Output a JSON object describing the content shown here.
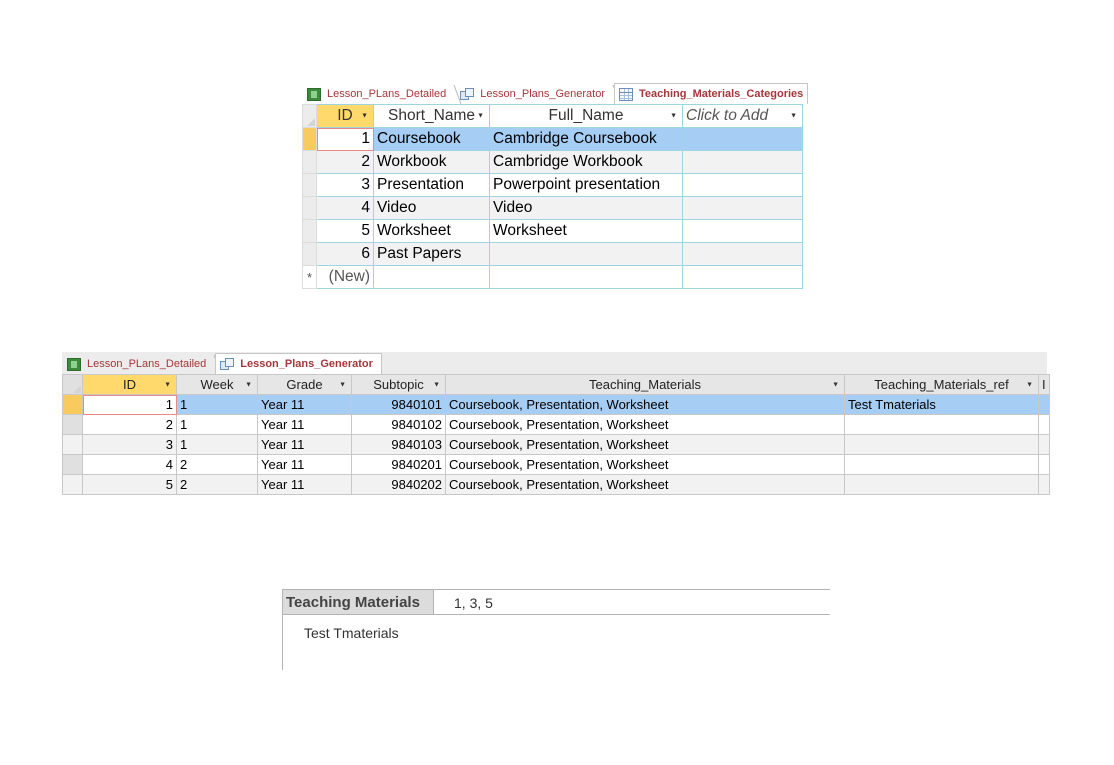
{
  "categories_view": {
    "tabs": [
      {
        "label": "Lesson_PLans_Detailed",
        "icon": "form-icon",
        "active": false
      },
      {
        "label": "Lesson_Plans_Generator",
        "icon": "query-icon",
        "active": false
      },
      {
        "label": "Teaching_Materials_Categories",
        "icon": "table-icon",
        "active": true
      }
    ],
    "columns": [
      "ID",
      "Short_Name",
      "Full_Name",
      "Click to Add"
    ],
    "rows": [
      {
        "id": "1",
        "short_name": "Coursebook",
        "full_name": "Cambridge Coursebook"
      },
      {
        "id": "2",
        "short_name": "Workbook",
        "full_name": "Cambridge Workbook"
      },
      {
        "id": "3",
        "short_name": "Presentation",
        "full_name": "Powerpoint presentation"
      },
      {
        "id": "4",
        "short_name": "Video",
        "full_name": "Video"
      },
      {
        "id": "5",
        "short_name": "Worksheet",
        "full_name": "Worksheet"
      },
      {
        "id": "6",
        "short_name": "Past Papers",
        "full_name": ""
      }
    ],
    "new_row_marker": "*",
    "new_row_label": "(New)"
  },
  "generator_view": {
    "tabs": [
      {
        "label": "Lesson_PLans_Detailed",
        "icon": "form-icon",
        "active": false
      },
      {
        "label": "Lesson_Plans_Generator",
        "icon": "query-icon",
        "active": true
      }
    ],
    "columns": [
      "ID",
      "Week",
      "Grade",
      "Subtopic",
      "Teaching_Materials",
      "Teaching_Materials_ref",
      "I"
    ],
    "rows": [
      {
        "id": "1",
        "week": "1",
        "grade": "Year 11",
        "subtopic": "9840101",
        "teaching_materials": "Coursebook, Presentation, Worksheet",
        "teaching_materials_ref": "Test Tmaterials"
      },
      {
        "id": "2",
        "week": "1",
        "grade": "Year 11",
        "subtopic": "9840102",
        "teaching_materials": "Coursebook, Presentation, Worksheet",
        "teaching_materials_ref": ""
      },
      {
        "id": "3",
        "week": "1",
        "grade": "Year 11",
        "subtopic": "9840103",
        "teaching_materials": "Coursebook, Presentation, Worksheet",
        "teaching_materials_ref": ""
      },
      {
        "id": "4",
        "week": "2",
        "grade": "Year 11",
        "subtopic": "9840201",
        "teaching_materials": "Coursebook, Presentation, Worksheet",
        "teaching_materials_ref": ""
      },
      {
        "id": "5",
        "week": "2",
        "grade": "Year 11",
        "subtopic": "9840202",
        "teaching_materials": "Coursebook, Presentation, Worksheet",
        "teaching_materials_ref": ""
      }
    ]
  },
  "form_control": {
    "label": "Teaching Materials",
    "value": "1, 3, 5",
    "memo": "Test Tmaterials"
  },
  "colors": {
    "tab_text": "#a4373a",
    "id_header": "#ffd96b",
    "selected_row": "#a6cdf3",
    "record_selector": "#f9cb5e",
    "grid_border_1": "#9fd5e2",
    "grid_border_2": "#c8c8c8"
  }
}
